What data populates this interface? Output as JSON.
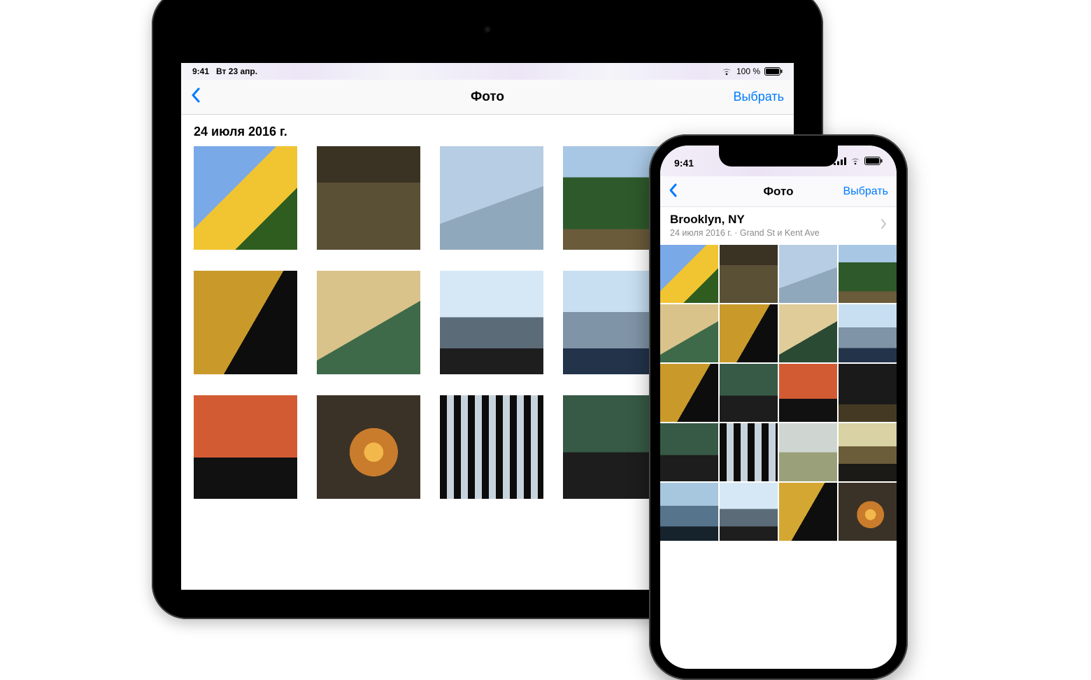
{
  "ipad": {
    "status": {
      "time": "9:41",
      "day": "Вт 23 апр.",
      "battery": "100 %"
    },
    "nav": {
      "title": "Фото",
      "select": "Выбрать"
    },
    "section_date": "24 июля 2016 г.",
    "thumbs": [
      "sunflower",
      "garage",
      "sunglasses",
      "trees",
      "yellowjacket",
      "blonde",
      "pier",
      "skyline",
      "yellowside",
      "orangewall",
      "sunset",
      "windows",
      "standing"
    ]
  },
  "iphone": {
    "status": {
      "time": "9:41"
    },
    "nav": {
      "title": "Фото",
      "select": "Выбрать"
    },
    "header": {
      "location": "Brooklyn, NY",
      "subtitle": "24 июля 2016 г.  ·  Grand St и Kent Ave"
    },
    "thumbs": [
      "sunflower",
      "garage",
      "sunglasses",
      "trees",
      "blonde",
      "yellowjacket",
      "blonde2",
      "skyline",
      "yellowjacket",
      "standing",
      "orangewall",
      "night",
      "standing",
      "windows",
      "clouds",
      "sunsetriver",
      "skyline2",
      "pier",
      "yellowside",
      "sunset"
    ]
  }
}
